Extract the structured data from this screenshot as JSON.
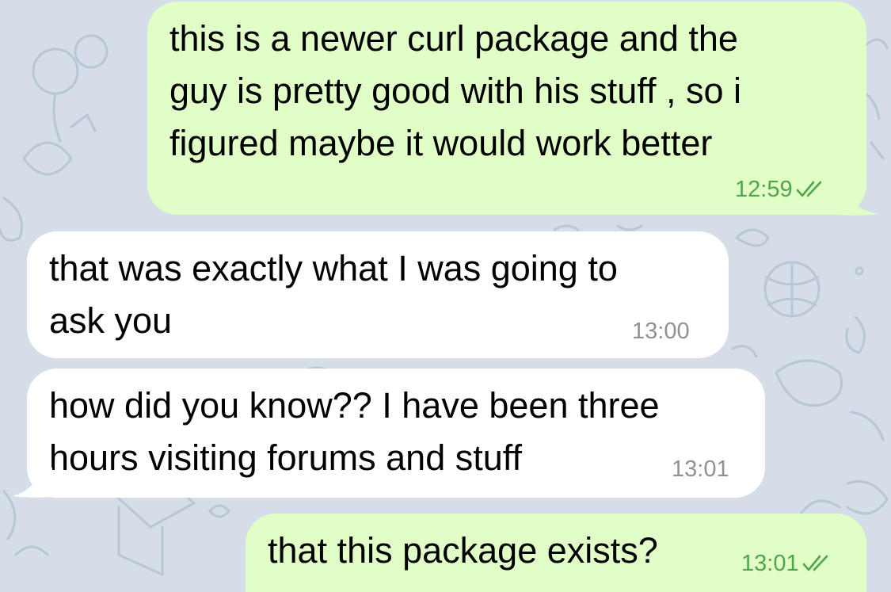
{
  "colors": {
    "outgoing_bubble": "#e1fec6",
    "incoming_bubble": "#ffffff",
    "outgoing_meta": "#4ea64a",
    "incoming_meta": "#8e9297",
    "wallpaper": "#d4dde8"
  },
  "messages": [
    {
      "direction": "outgoing",
      "text": "this is a newer curl package and the\nguy is pretty good with his stuff , so i\nfigured maybe it would work better",
      "time": "12:59",
      "status_icon": "double-check-icon"
    },
    {
      "direction": "incoming",
      "text": "that was exactly what I was going to\nask you",
      "time": "13:00"
    },
    {
      "direction": "incoming",
      "text": "how did you know?? I have been three\nhours visiting forums and stuff",
      "time": "13:01"
    },
    {
      "direction": "outgoing",
      "text": "that this package exists?",
      "time": "13:01",
      "status_icon": "double-check-icon"
    }
  ]
}
